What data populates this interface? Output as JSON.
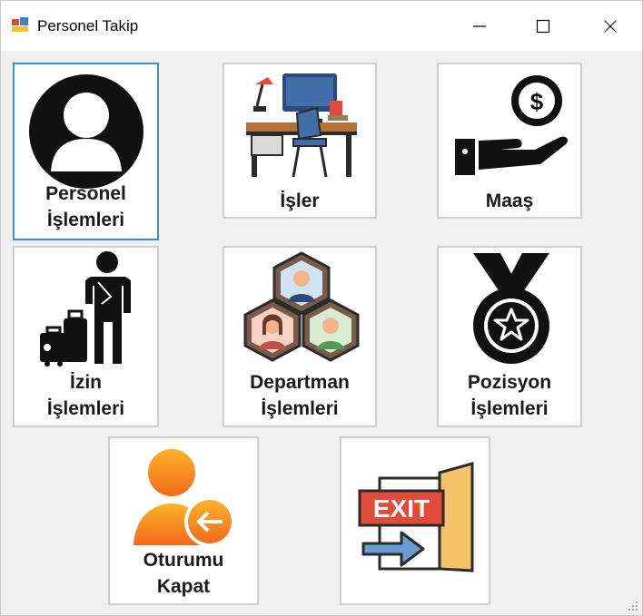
{
  "window": {
    "title": "Personel Takip",
    "icon": "app-form-icon"
  },
  "titlebar_buttons": {
    "minimize": "minimize-icon",
    "maximize": "maximize-icon",
    "close": "close-icon"
  },
  "buttons": {
    "personel": {
      "line1": "Personel",
      "line2": "İşlemleri",
      "icon": "person-icon"
    },
    "isler": {
      "line1": "İşler",
      "icon": "desk-icon"
    },
    "maas": {
      "line1": "Maaş",
      "icon": "salary-icon"
    },
    "izin": {
      "line1": "İzin",
      "line2": "İşlemleri",
      "icon": "traveler-icon"
    },
    "departman": {
      "line1": "Departman",
      "line2": "İşlemleri",
      "icon": "department-icon"
    },
    "pozisyon": {
      "line1": "Pozisyon",
      "line2": "İşlemleri",
      "icon": "medal-icon"
    },
    "oturum": {
      "line1": "Oturumu",
      "line2": "Kapat",
      "icon": "logout-user-icon"
    },
    "exit": {
      "sign": "EXIT",
      "icon": "exit-door-icon"
    }
  }
}
